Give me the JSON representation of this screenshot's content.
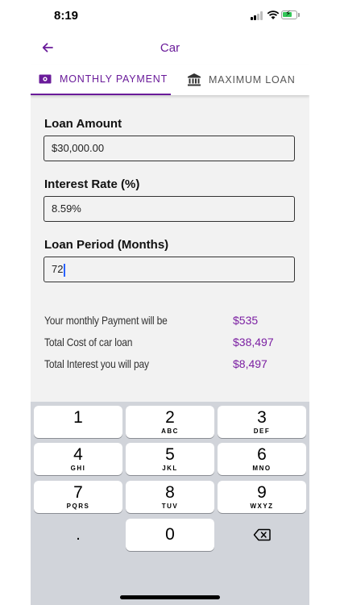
{
  "status": {
    "time": "8:19"
  },
  "appbar": {
    "title": "Car"
  },
  "tabs": [
    {
      "label": "MONTHLY PAYMENT",
      "icon": "cash-icon",
      "active": true
    },
    {
      "label": "MAXIMUM LOAN",
      "icon": "bank-icon",
      "active": false
    }
  ],
  "form": {
    "loan_amount_label": "Loan Amount",
    "loan_amount_value": "$30,000.00",
    "interest_label": "Interest Rate (%)",
    "interest_value": "8.59%",
    "period_label": "Loan Period (Months)",
    "period_value": "72"
  },
  "results": {
    "monthly_label": "Your monthly Payment will be",
    "monthly_value": "$535",
    "total_cost_label": "Total Cost of car loan",
    "total_cost_value": "$38,497",
    "interest_label": "Total Interest you will pay",
    "interest_value": "$8,497"
  },
  "keyboard": {
    "keys": [
      {
        "num": "1",
        "sub": ""
      },
      {
        "num": "2",
        "sub": "ABC"
      },
      {
        "num": "3",
        "sub": "DEF"
      },
      {
        "num": "4",
        "sub": "GHI"
      },
      {
        "num": "5",
        "sub": "JKL"
      },
      {
        "num": "6",
        "sub": "MNO"
      },
      {
        "num": "7",
        "sub": "PQRS"
      },
      {
        "num": "8",
        "sub": "TUV"
      },
      {
        "num": "9",
        "sub": "WXYZ"
      },
      {
        "num": ".",
        "sub": ""
      },
      {
        "num": "0",
        "sub": ""
      }
    ]
  },
  "colors": {
    "accent": "#6a1b9a",
    "result_value": "#7b1fa2",
    "keyboard_bg": "#d1d4da"
  }
}
